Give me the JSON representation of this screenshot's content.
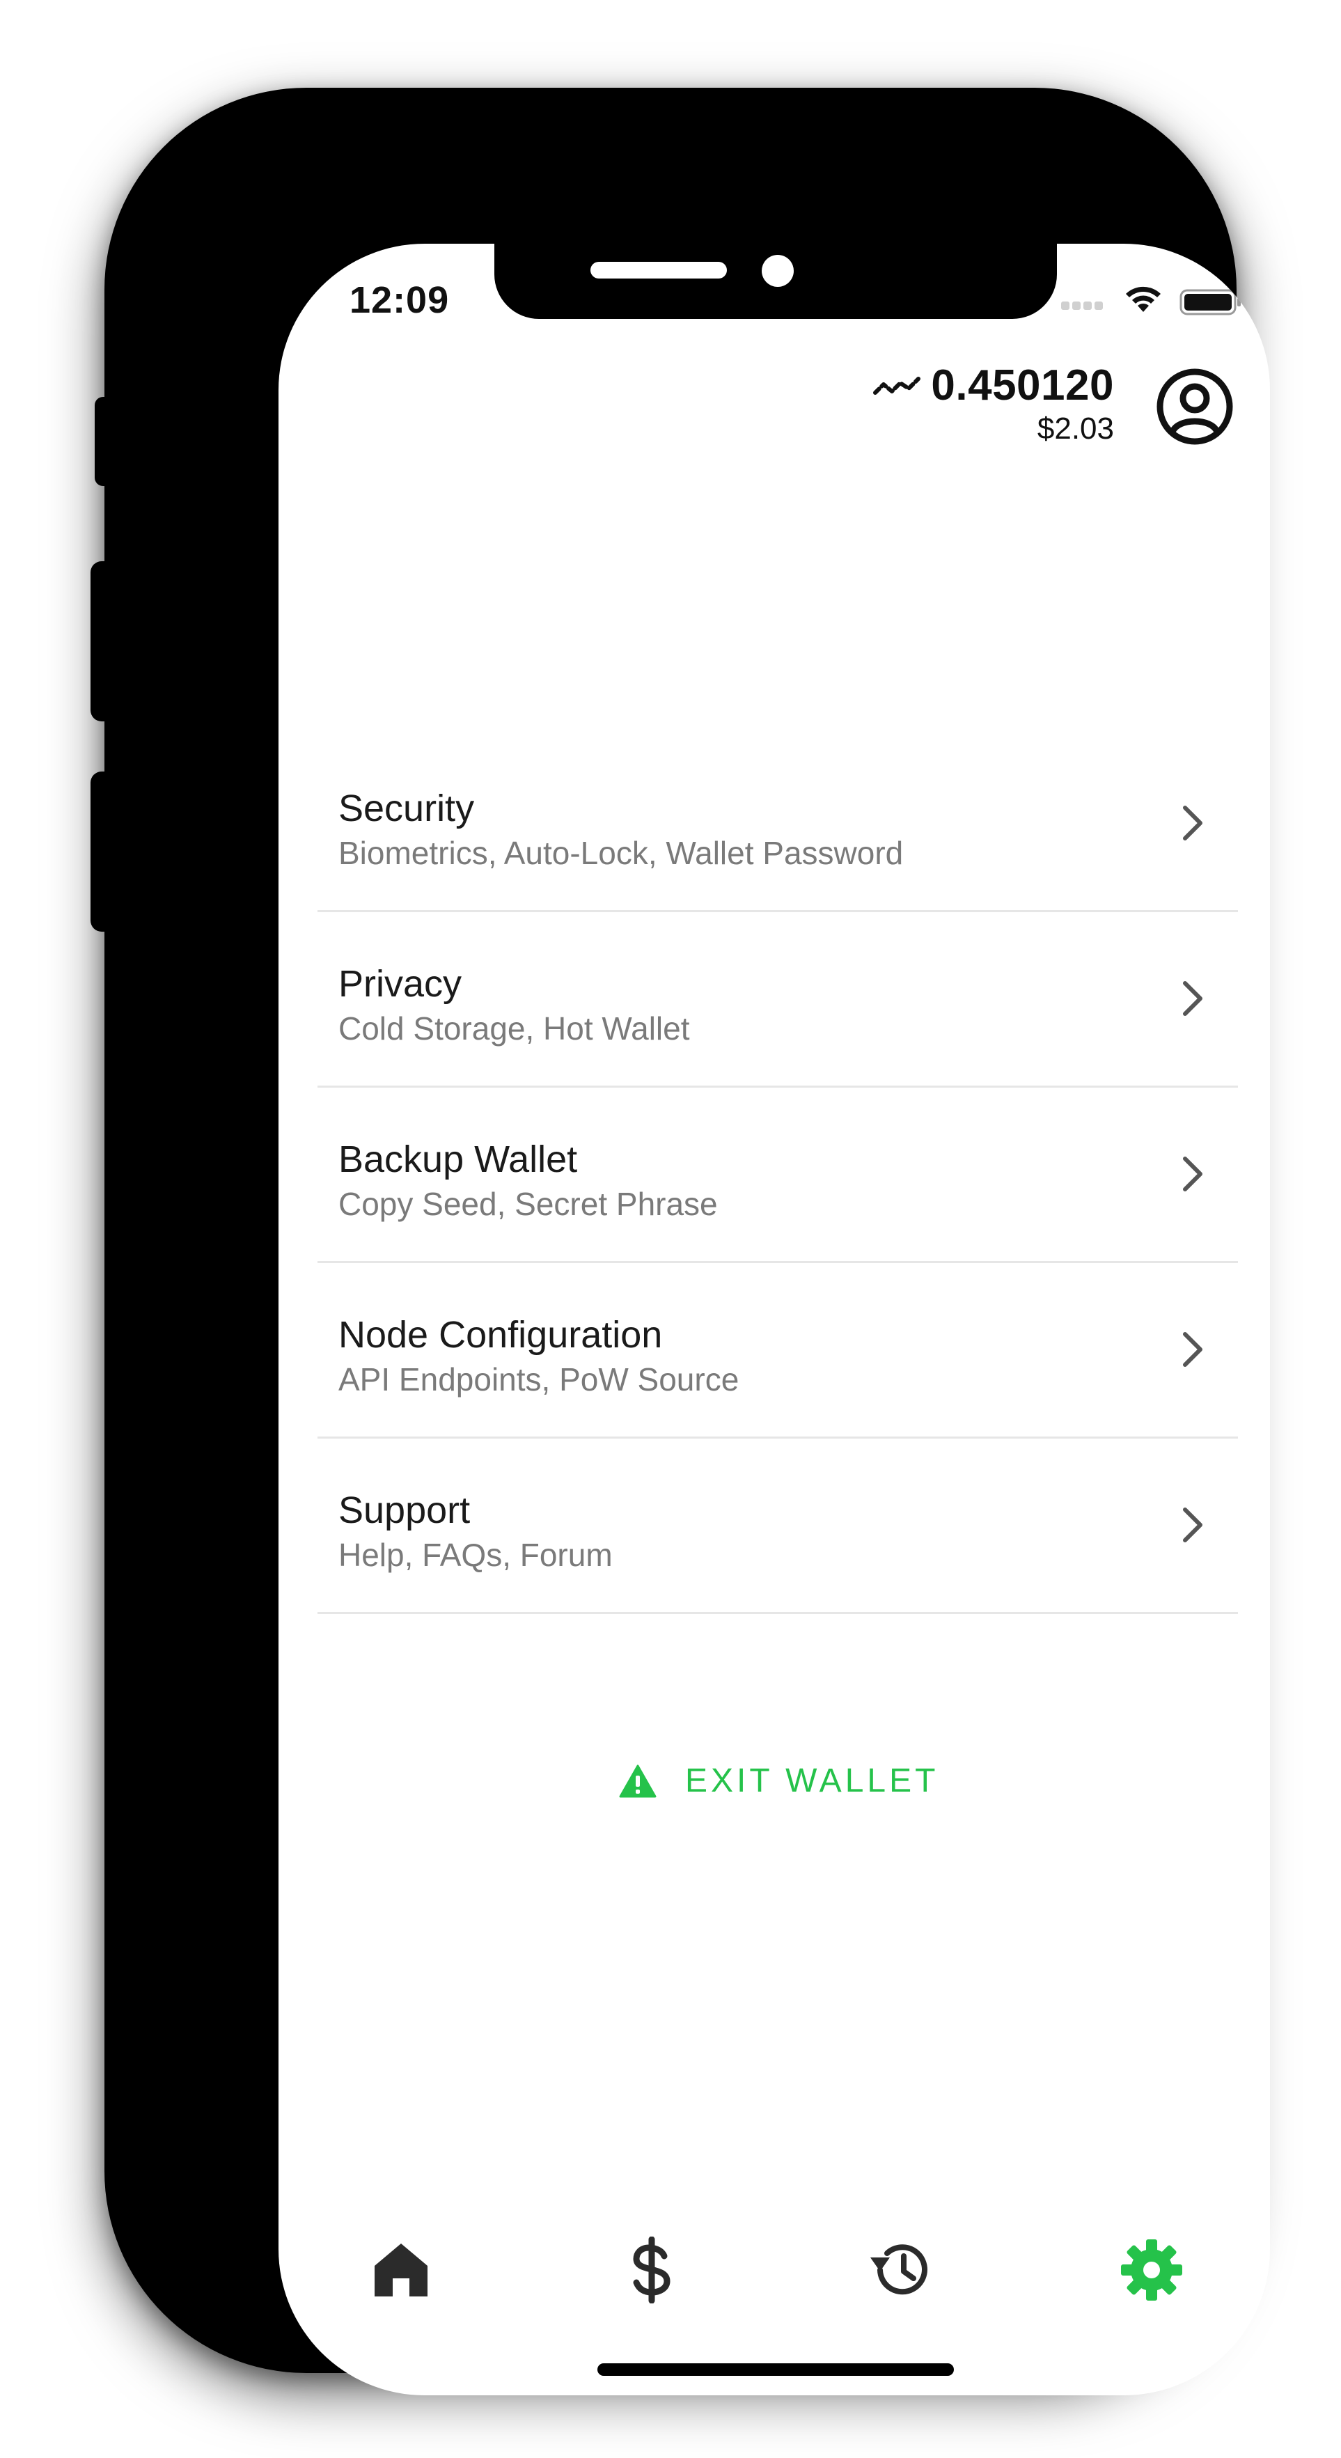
{
  "status_bar": {
    "time": "12:09",
    "icons": [
      "signal-dots-icon",
      "wifi-icon",
      "battery-icon"
    ]
  },
  "header": {
    "balance": "0.450120",
    "fiat": "$2.03",
    "balance_icon": "trend-icon",
    "profile_icon": "profile-icon"
  },
  "menu": {
    "items": [
      {
        "title": "Security",
        "subtitle": "Biometrics, Auto-Lock, Wallet Password"
      },
      {
        "title": "Privacy",
        "subtitle": "Cold Storage, Hot Wallet"
      },
      {
        "title": "Backup Wallet",
        "subtitle": "Copy Seed, Secret Phrase"
      },
      {
        "title": "Node Configuration",
        "subtitle": "API Endpoints, PoW Source"
      },
      {
        "title": "Support",
        "subtitle": "Help, FAQs, Forum"
      }
    ]
  },
  "exit": {
    "label": "EXIT WALLET",
    "icon": "warning-icon"
  },
  "tabbar": {
    "tabs": [
      {
        "icon": "home-icon",
        "active": false
      },
      {
        "icon": "dollar-icon",
        "active": false
      },
      {
        "icon": "history-icon",
        "active": false
      },
      {
        "icon": "gear-icon",
        "active": true
      }
    ]
  },
  "colors": {
    "accent": "#25c24a",
    "text_primary": "#1a1a1a",
    "text_secondary": "#7a7a7a",
    "icon_inactive": "#2b2b2b",
    "divider": "#e6e6e6"
  }
}
